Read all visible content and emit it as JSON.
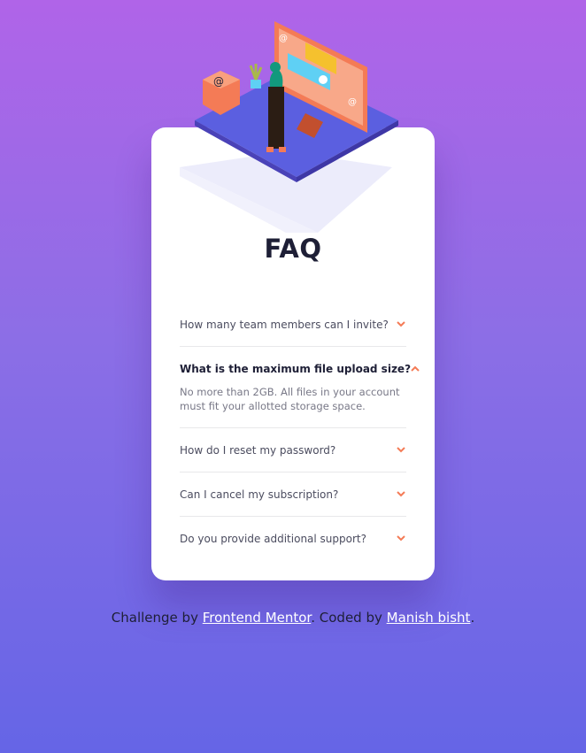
{
  "faq": {
    "title": "FAQ",
    "items": [
      {
        "question": "How many team members can I invite?",
        "open": false
      },
      {
        "question": "What is the maximum file upload size?",
        "open": true,
        "answer": "No more than 2GB. All files in your account must fit your allotted storage space."
      },
      {
        "question": "How do I reset my password?",
        "open": false
      },
      {
        "question": "Can I cancel my subscription?",
        "open": false
      },
      {
        "question": "Do you provide additional support?",
        "open": false
      }
    ]
  },
  "attribution": {
    "prefix": "Challenge by",
    "link1": "Frontend Mentor",
    "middle": ". Coded by",
    "link2": "Manish bisht",
    "suffix": "."
  },
  "colors": {
    "accent": "#f47b56",
    "heading": "#1e1f36",
    "text": "#4b4c5f",
    "muted": "#787887",
    "bg_top": "#b064e8",
    "bg_bottom": "#6565e6"
  },
  "icons": {
    "chevron_closed": "chevron-down-icon",
    "chevron_open": "chevron-up-icon"
  }
}
